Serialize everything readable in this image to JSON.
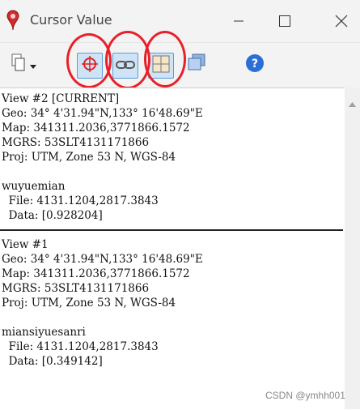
{
  "window": {
    "title": "Cursor Value"
  },
  "views": [
    {
      "header": "View #2 [CURRENT]",
      "geo": "Geo: 34° 4'31.94\"N,133° 16'48.69\"E",
      "map": "Map: 341311.2036,3771866.1572",
      "mgrs": "MGRS: 53SLT4131171866",
      "proj": "Proj: UTM, Zone 53 N, WGS-84",
      "layer_name": "wuyuemian",
      "file": "  File: 4131.1204,2817.3843",
      "data": "  Data: [0.928204]"
    },
    {
      "header": "View #1",
      "geo": "Geo: 34° 4'31.94\"N,133° 16'48.69\"E",
      "map": "Map: 341311.2036,3771866.1572",
      "mgrs": "MGRS: 53SLT4131171866",
      "proj": "Proj: UTM, Zone 53 N, WGS-84",
      "layer_name": "miansiyuesanri",
      "file": "  File: 4131.1204,2817.3843",
      "data": "  Data: [0.349142]"
    }
  ],
  "watermark": "CSDN @ymhh001",
  "colors": {
    "annotation": "#e8202a",
    "pressed_button": "#cfe3f7",
    "help_icon": "#2b6fd6"
  },
  "icons": {
    "app": "map-pin-icon",
    "copy_menu": "copy-document-icon",
    "crosshair": "crosshair-icon",
    "link": "link-icon",
    "grid": "grid-icon",
    "layers": "layers-icon",
    "help": "help-icon"
  }
}
